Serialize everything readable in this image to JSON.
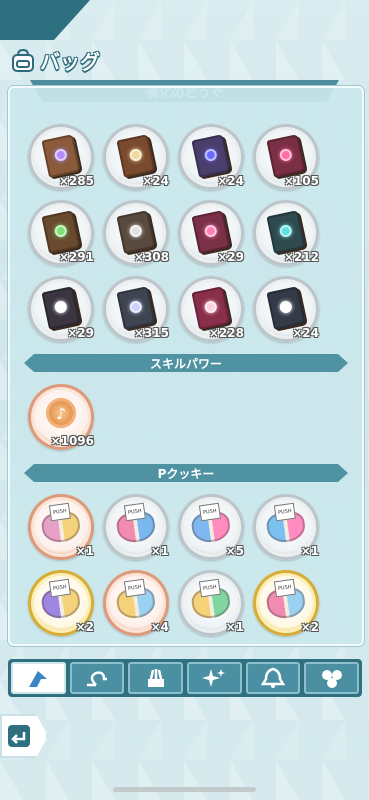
{
  "header": {
    "title": "バッグ",
    "icon": "bag-icon"
  },
  "sections": {
    "tools": {
      "title": "強化のどうぐ",
      "items": [
        {
          "type": "book",
          "cover": "#8a5a3b",
          "gem": "#b58cff",
          "count": "×285"
        },
        {
          "type": "book",
          "cover": "#7a4a2e",
          "gem": "#f0d9a0",
          "count": "×24"
        },
        {
          "type": "book",
          "cover": "#4a3f6b",
          "gem": "#6a6bff",
          "count": "×24"
        },
        {
          "type": "book",
          "cover": "#7a2f45",
          "gem": "#ff6fa6",
          "count": "×105"
        },
        {
          "type": "book",
          "cover": "#6a4a2e",
          "gem": "#7fe07a",
          "count": "×291"
        },
        {
          "type": "book",
          "cover": "#5a4a3e",
          "gem": "#e0e0e0",
          "count": "×308"
        },
        {
          "type": "book",
          "cover": "#7a3046",
          "gem": "#ff7fb5",
          "count": "×29"
        },
        {
          "type": "book",
          "cover": "#2f4a4f",
          "gem": "#5fe0e0",
          "count": "×212"
        },
        {
          "type": "book",
          "cover": "#3a3540",
          "gem": "#ffffff",
          "count": "×29"
        },
        {
          "type": "book",
          "cover": "#3e4450",
          "gem": "#d0d0ff",
          "count": "×315"
        },
        {
          "type": "book",
          "cover": "#8a2f4a",
          "gem": "#ffd0e0",
          "count": "×228"
        },
        {
          "type": "book",
          "cover": "#353a48",
          "gem": "#ffffff",
          "count": "×24"
        }
      ]
    },
    "skill": {
      "title": "スキルパワー",
      "items": [
        {
          "type": "medal",
          "count": "×1096"
        }
      ]
    },
    "cookie": {
      "title": "Pクッキー",
      "items": [
        {
          "type": "cookie",
          "frame": "bronze",
          "c1": "#e7a0c8",
          "c2": "#f3d27a",
          "count": "×1"
        },
        {
          "type": "cookie",
          "frame": "silver",
          "c1": "#f28bb0",
          "c2": "#7ab8f0",
          "count": "×1"
        },
        {
          "type": "cookie",
          "frame": "silver",
          "c1": "#7fb8f0",
          "c2": "#ff8cc0",
          "count": "×5"
        },
        {
          "type": "cookie",
          "frame": "silver",
          "c1": "#7ac0f0",
          "c2": "#ff8cc0",
          "count": "×1"
        },
        {
          "type": "cookie",
          "frame": "gold",
          "c1": "#9f86e0",
          "c2": "#f3d27a",
          "count": "×2"
        },
        {
          "type": "cookie",
          "frame": "bronze",
          "c1": "#f3d27a",
          "c2": "#9ad0f0",
          "count": "×4"
        },
        {
          "type": "cookie",
          "frame": "silver",
          "c1": "#f3d27a",
          "c2": "#7fd6a0",
          "count": "×1"
        },
        {
          "type": "cookie",
          "frame": "gold",
          "c1": "#f28bb0",
          "c2": "#9ad0f0",
          "count": "×2"
        }
      ]
    }
  },
  "tabs": [
    {
      "icon": "arrow-up-icon",
      "active": true
    },
    {
      "icon": "loop-icon",
      "active": false
    },
    {
      "icon": "cake-icon",
      "active": false
    },
    {
      "icon": "sparkle-icon",
      "active": false
    },
    {
      "icon": "bell-icon",
      "active": false
    },
    {
      "icon": "hexagon-icon",
      "active": false
    }
  ],
  "back": {
    "icon": "back-arrow-icon"
  }
}
